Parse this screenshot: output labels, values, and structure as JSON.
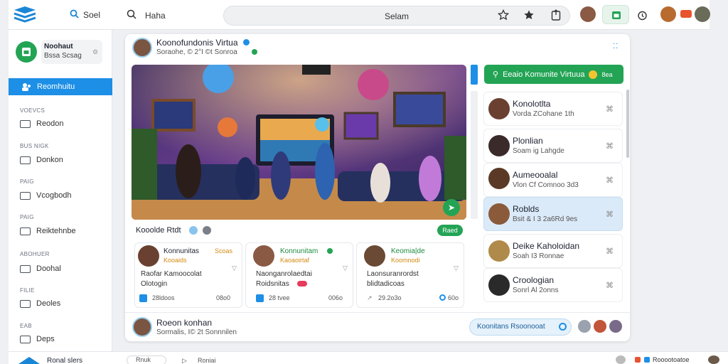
{
  "topbar": {
    "search_link": "Soel",
    "home_link": "Haha",
    "search_placeholder": "Selam"
  },
  "sidebar": {
    "profile_name": "Noohaut",
    "profile_sub": "Bssa Scsag",
    "active_item": "Reomhuitu",
    "sections": [
      {
        "title": "VOEVCS",
        "item": "Reodon"
      },
      {
        "title": "BUS NIGK",
        "item": "Donkon"
      },
      {
        "title": "PAIG",
        "item": "Vcogbodh"
      },
      {
        "title": "PAIG",
        "item": "Reiktehnbe"
      },
      {
        "title": "ABOHUER",
        "item": "Doohal"
      },
      {
        "title": "FILIE",
        "item": "Deoles"
      },
      {
        "title": "EAB",
        "item": "Deps"
      }
    ],
    "bottom_label": "Ronal slers"
  },
  "post": {
    "author": "Koonofundonis Virtua",
    "meta": "Soraohe, © 2°I ©t Sonroa",
    "room_label": "Kooolde Rtdt",
    "join_label": "Raed",
    "cards": [
      {
        "name": "Konnunitas",
        "tag": "Scoas",
        "subtag": "Kooaids",
        "line1": "Raofar Kamoocolat",
        "line2": "Olotogin",
        "likes": "28ldoos",
        "comments": "08o0"
      },
      {
        "name": "Konnunitam",
        "tag": "",
        "subtag": "Kaoaoirtaf",
        "line1": "Naonganrolaedtai",
        "line2": "Roidsnitas",
        "likes": "28 tvee",
        "comments": "006o"
      },
      {
        "name": "Keomia|de",
        "tag": "",
        "subtag": "Koomnodi",
        "line1": "Laonsuranrordst",
        "line2": "blidtadicoas",
        "likes": "29.2o3o",
        "comments": "60o"
      }
    ],
    "footer_author": "Roeon konhan",
    "footer_meta": "Sormalis, I© 2t Sonnnilen",
    "community_button": "Koonitans Rsoonooat"
  },
  "panel": {
    "join_button": "Eeaio Komunite Virtuua",
    "join_count": "8ea",
    "members": [
      {
        "name": "Konolotlta",
        "sub": "Vorda ZCohane 1th"
      },
      {
        "name": "Plonlian",
        "sub": "Soam ig Lahgde"
      },
      {
        "name": "Aumeooalal",
        "sub": "Vlon Cf Comnoo 3d3"
      },
      {
        "name": "Roblds",
        "sub": "Bsit & I 3 2a6Rd 9es"
      },
      {
        "name": "Deike Kaholoidan",
        "sub": "Soah I3 Ronnae"
      },
      {
        "name": "Croologian",
        "sub": "Sonrl Al 2onns"
      }
    ]
  },
  "bottom": {
    "tab1": "Rnuk",
    "tab2": "Roniai",
    "right_label": "Rooootoatoe"
  }
}
